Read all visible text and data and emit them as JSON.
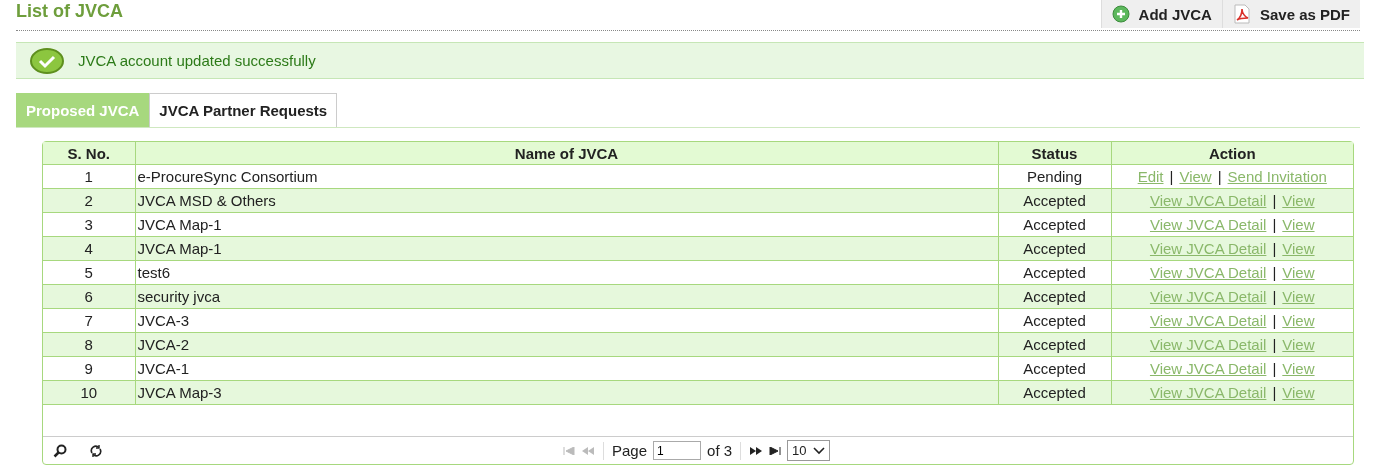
{
  "page": {
    "title": "List of JVCA"
  },
  "toolbar": [
    {
      "kind": "add",
      "label": "Add JVCA"
    },
    {
      "kind": "pdf",
      "label": "Save as PDF"
    }
  ],
  "alert": {
    "message": "JVCA account updated successfully"
  },
  "tabs": [
    {
      "label": "Proposed JVCA",
      "selected": true
    },
    {
      "label": "JVCA Partner Requests",
      "selected": false
    }
  ],
  "table": {
    "columns": [
      "S. No.",
      "Name of JVCA",
      "Status",
      "Action"
    ],
    "rows": [
      {
        "sno": "1",
        "name": "e-ProcureSync Consortium",
        "status": "Pending",
        "actions": [
          {
            "kind": "link",
            "text": "Edit"
          },
          {
            "kind": "separator",
            "text": "|"
          },
          {
            "kind": "link",
            "text": "View"
          },
          {
            "kind": "separator",
            "text": "|"
          },
          {
            "kind": "link",
            "text": "Send Invitation"
          }
        ]
      },
      {
        "sno": "2",
        "name": "JVCA MSD & Others",
        "status": "Accepted",
        "actions": [
          {
            "kind": "link",
            "text": "View JVCA Detail"
          },
          {
            "kind": "separator",
            "text": "|"
          },
          {
            "kind": "link",
            "text": "View"
          }
        ]
      },
      {
        "sno": "3",
        "name": "JVCA Map-1",
        "status": "Accepted",
        "actions": [
          {
            "kind": "link",
            "text": "View JVCA Detail"
          },
          {
            "kind": "separator",
            "text": "|"
          },
          {
            "kind": "link",
            "text": "View"
          }
        ]
      },
      {
        "sno": "4",
        "name": "JVCA Map-1",
        "status": "Accepted",
        "actions": [
          {
            "kind": "link",
            "text": "View JVCA Detail"
          },
          {
            "kind": "separator",
            "text": "|"
          },
          {
            "kind": "link",
            "text": "View"
          }
        ]
      },
      {
        "sno": "5",
        "name": "test6",
        "status": "Accepted",
        "actions": [
          {
            "kind": "link",
            "text": "View JVCA Detail"
          },
          {
            "kind": "separator",
            "text": "|"
          },
          {
            "kind": "link",
            "text": "View"
          }
        ]
      },
      {
        "sno": "6",
        "name": "security jvca",
        "status": "Accepted",
        "actions": [
          {
            "kind": "link",
            "text": "View JVCA Detail"
          },
          {
            "kind": "separator",
            "text": "|"
          },
          {
            "kind": "link",
            "text": "View"
          }
        ]
      },
      {
        "sno": "7",
        "name": "JVCA-3",
        "status": "Accepted",
        "actions": [
          {
            "kind": "link",
            "text": "View JVCA Detail"
          },
          {
            "kind": "separator",
            "text": "|"
          },
          {
            "kind": "link",
            "text": "View"
          }
        ]
      },
      {
        "sno": "8",
        "name": "JVCA-2",
        "status": "Accepted",
        "actions": [
          {
            "kind": "link",
            "text": "View JVCA Detail"
          },
          {
            "kind": "separator",
            "text": "|"
          },
          {
            "kind": "link",
            "text": "View"
          }
        ]
      },
      {
        "sno": "9",
        "name": "JVCA-1",
        "status": "Accepted",
        "actions": [
          {
            "kind": "link",
            "text": "View JVCA Detail"
          },
          {
            "kind": "separator",
            "text": "|"
          },
          {
            "kind": "link",
            "text": "View"
          }
        ]
      },
      {
        "sno": "10",
        "name": "JVCA Map-3",
        "status": "Accepted",
        "actions": [
          {
            "kind": "link",
            "text": "View JVCA Detail"
          },
          {
            "kind": "separator",
            "text": "|"
          },
          {
            "kind": "link",
            "text": "View"
          }
        ]
      }
    ]
  },
  "pager": {
    "page_label": "Page",
    "page": "1",
    "of_label": "of 3",
    "page_size": "10"
  }
}
